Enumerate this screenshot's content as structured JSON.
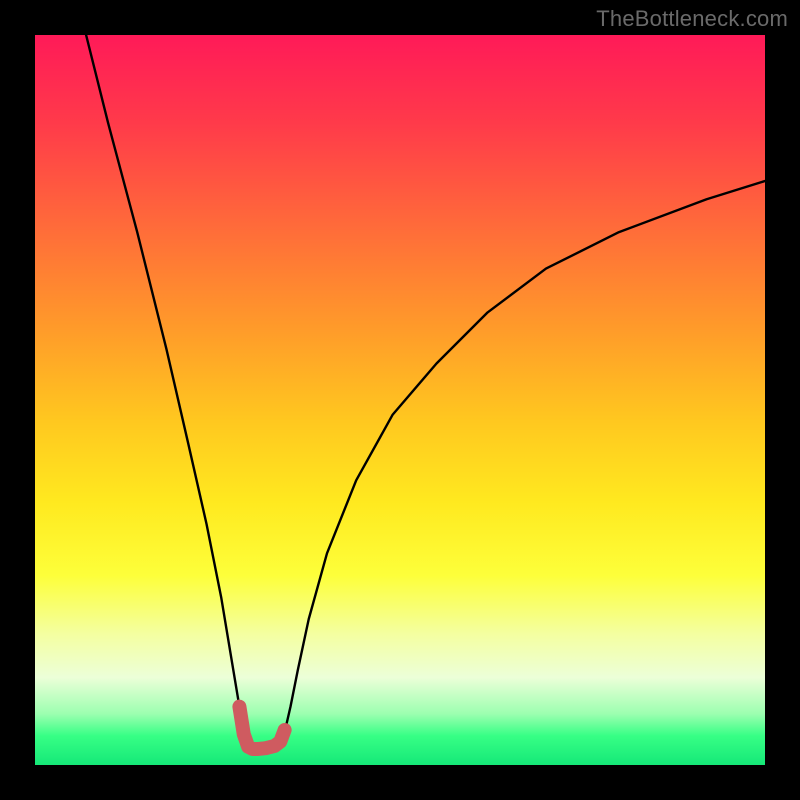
{
  "watermark": "TheBottleneck.com",
  "chart_data": {
    "type": "line",
    "title": "",
    "xlabel": "",
    "ylabel": "",
    "xlim": [
      0,
      100
    ],
    "ylim": [
      0,
      100
    ],
    "series": [
      {
        "name": "black-curve",
        "x": [
          7,
          10,
          14,
          18,
          21,
          23.5,
          25.5,
          27,
          28,
          28.8,
          29.5,
          30.5,
          32,
          33.3,
          34.2,
          35,
          36,
          37.5,
          40,
          44,
          49,
          55,
          62,
          70,
          80,
          92,
          100
        ],
        "y": [
          100,
          88,
          73,
          57,
          44,
          33,
          23,
          14,
          8,
          4,
          2.3,
          2.2,
          2.4,
          3.0,
          4.5,
          8,
          13,
          20,
          29,
          39,
          48,
          55,
          62,
          68,
          73,
          77.5,
          80
        ]
      },
      {
        "name": "red-trough",
        "x": [
          28,
          28.6,
          29.2,
          29.8,
          30.6,
          31.6,
          32.8,
          33.6,
          34.2
        ],
        "y": [
          8,
          4.2,
          2.5,
          2.2,
          2.2,
          2.3,
          2.6,
          3.2,
          4.8
        ]
      }
    ],
    "background_gradient": {
      "top": "#ff1a58",
      "mid": "#ffe91f",
      "bottom": "#15e878"
    }
  }
}
